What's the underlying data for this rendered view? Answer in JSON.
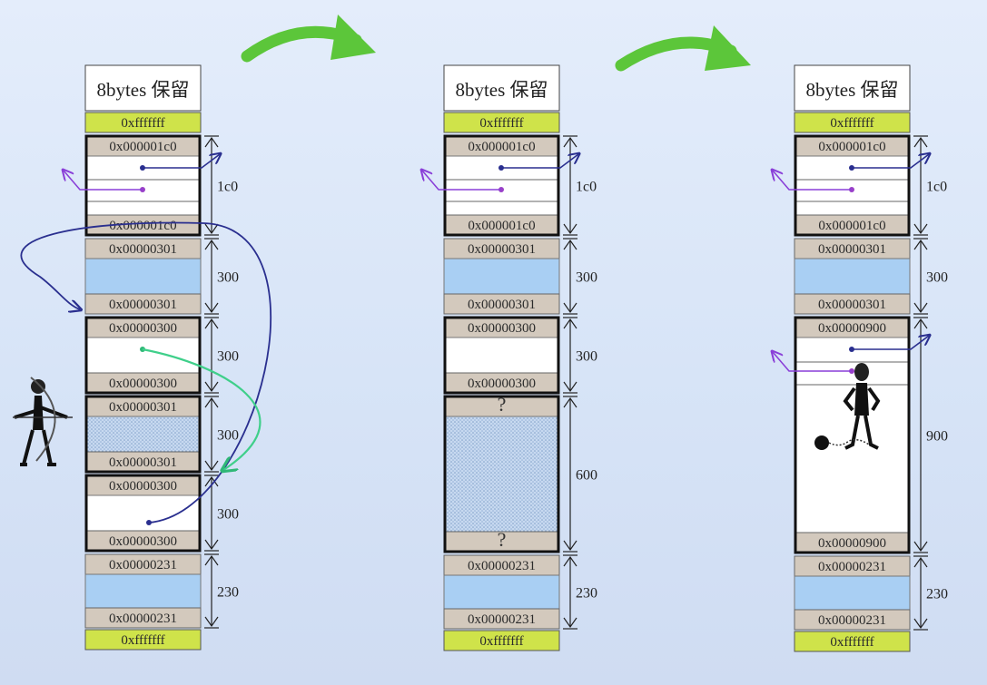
{
  "header_label": "8bytes 保留",
  "colors": {
    "header_fill": "#ffffff",
    "sentinel_fill": "#cfe34a",
    "size_fill": "#d3c9bd",
    "payload_fill": "#a9cff3",
    "hatched_fill": "#bfd4ee",
    "pointer_purple": "#7a2fd0",
    "pointer_navy": "#2a2f8f",
    "curve_green": "#3fcf8a",
    "big_arrow_green": "#5cc63a"
  },
  "columns": [
    {
      "name": "before",
      "top_sentinel": "0xfffffff",
      "bottom_sentinel": "0xfffffff",
      "chunks": [
        {
          "header": "0x000001c0",
          "footer": "0x000001c0",
          "body": "free-list",
          "size_label": "1c0"
        },
        {
          "header": "0x00000301",
          "footer": "0x00000301",
          "body": "allocated",
          "size_label": "300"
        },
        {
          "header": "0x00000300",
          "footer": "0x00000300",
          "body": "free",
          "size_label": "300"
        },
        {
          "header": "0x00000301",
          "footer": "0x00000301",
          "body": "hatched",
          "size_label": "300"
        },
        {
          "header": "0x00000300",
          "footer": "0x00000300",
          "body": "free-one-ptr",
          "size_label": "300"
        },
        {
          "header": "0x00000231",
          "footer": "0x00000231",
          "body": "allocated",
          "size_label": "230"
        }
      ]
    },
    {
      "name": "merged-unknown",
      "top_sentinel": "0xfffffff",
      "bottom_sentinel": "0xfffffff",
      "chunks": [
        {
          "header": "0x000001c0",
          "footer": "0x000001c0",
          "body": "free-list",
          "size_label": "1c0"
        },
        {
          "header": "0x00000301",
          "footer": "0x00000301",
          "body": "allocated",
          "size_label": "300"
        },
        {
          "header": "0x00000300",
          "footer": "0x00000300",
          "body": "free-empty",
          "size_label": "300"
        },
        {
          "header": "?",
          "footer": "?",
          "body": "hatched",
          "size_label": "600"
        },
        {
          "header": "0x00000231",
          "footer": "0x00000231",
          "body": "allocated",
          "size_label": "230"
        }
      ]
    },
    {
      "name": "after-coalesce",
      "top_sentinel": "0xfffffff",
      "bottom_sentinel": "0xfffffff",
      "chunks": [
        {
          "header": "0x000001c0",
          "footer": "0x000001c0",
          "body": "free-list",
          "size_label": "1c0"
        },
        {
          "header": "0x00000301",
          "footer": "0x00000301",
          "body": "allocated",
          "size_label": "300"
        },
        {
          "header": "0x00000900",
          "footer": "0x00000900",
          "body": "big-free",
          "size_label": "900"
        },
        {
          "header": "0x00000231",
          "footer": "0x00000231",
          "body": "allocated",
          "size_label": "230"
        }
      ]
    }
  ],
  "icons": [
    "archer-icon",
    "prisoner-icon",
    "ball-and-chain-icon"
  ]
}
